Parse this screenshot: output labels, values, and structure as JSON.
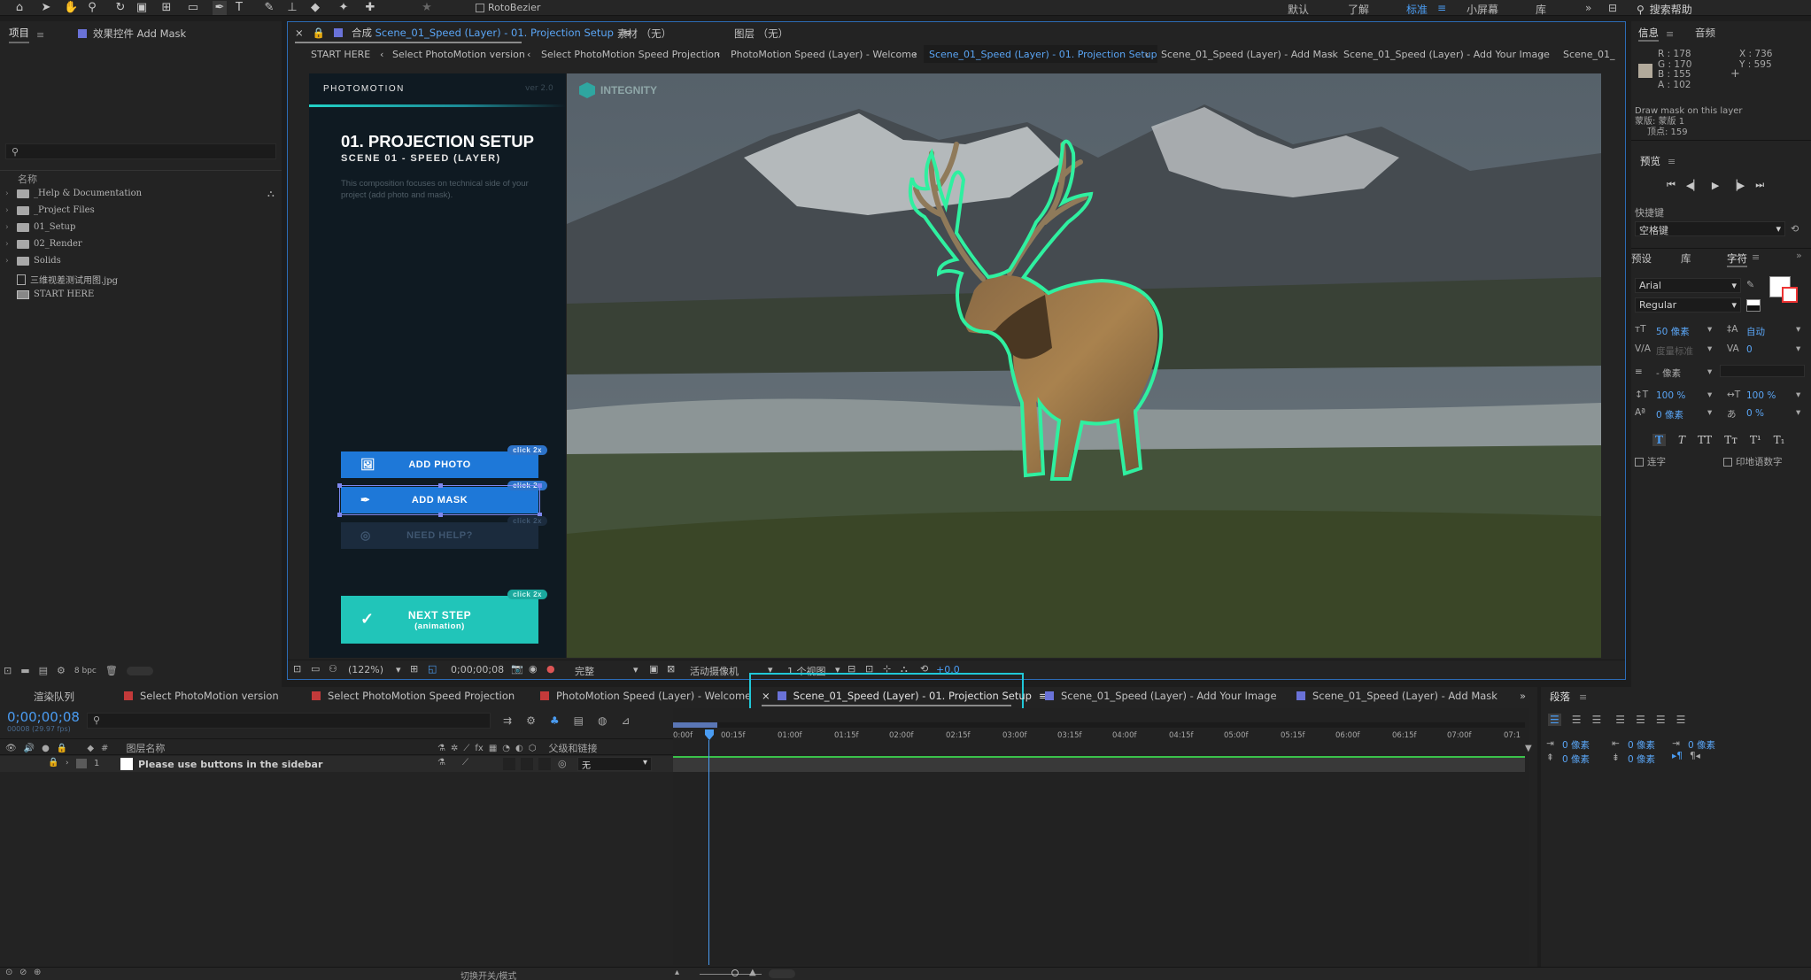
{
  "toolbar": {
    "roto_label": "RotoBezier",
    "workspaces": [
      "默认",
      "了解",
      "标准",
      "小屏幕",
      "库"
    ],
    "search_help": "搜索帮助"
  },
  "project": {
    "tab": "项目",
    "effects_tab": "效果控件 Add Mask",
    "name_col": "名称",
    "items": [
      "_Help & Documentation",
      "_Project Files",
      "01_Setup",
      "02_Render",
      "Solids",
      "三维视差测试用图.jpg",
      "START HERE"
    ],
    "bpc": "8 bpc"
  },
  "comp": {
    "tab_prefix": "合成",
    "tab_name": "Scene_01_Speed (Layer) - 01. Projection Setup",
    "footage_tab": "素材 （无）",
    "layer_tab": "图层 （无）",
    "breadcrumbs": [
      "START HERE",
      "Select PhotoMotion version",
      "Select PhotoMotion Speed Projection",
      "PhotoMotion Speed (Layer) - Welcome",
      "Scene_01_Speed (Layer) - 01. Projection Setup",
      "Scene_01_Speed (Layer) - Add Mask",
      "Scene_01_Speed (Layer) - Add Your Image",
      "Scene_01_"
    ],
    "zoom": "(122%)",
    "timecode": "0;00;00;08",
    "quality": "完整",
    "camera": "活动摄像机",
    "views": "1 个视图",
    "exposure": "+0.0"
  },
  "photomotion": {
    "logo": "PHOTOMOTION",
    "version": "ver 2.0",
    "title": "01. PROJECTION SETUP",
    "subtitle": "SCENE 01 - SPEED (LAYER)",
    "description": "This composition focuses on technical side of your project (add photo and mask).",
    "add_photo": "ADD PHOTO",
    "add_mask": "ADD MASK",
    "need_help": "NEED HELP?",
    "click_tag": "click 2x",
    "next_step": "NEXT STEP",
    "next_sub": "(animation)",
    "brand": "INTEGNITY"
  },
  "info": {
    "tab": "信息",
    "audio_tab": "音频",
    "r": "R : 178",
    "g": "G : 170",
    "b": "B : 155",
    "a": "A : 102",
    "x": "X : 736",
    "y": "Y : 595",
    "swatch": "#b2aa9b",
    "hint1": "Draw mask on this layer",
    "hint2": "蒙版: 蒙版 1",
    "hint3": "顶点: 159"
  },
  "preview": {
    "tab": "预览",
    "shortcut_label": "快捷键",
    "shortcut_value": "空格键"
  },
  "character": {
    "tabs": [
      "预设",
      "库",
      "字符"
    ],
    "font": "Arial",
    "style": "Regular",
    "size": "50 像素",
    "leading": "自动",
    "kerning": "度量标准",
    "tracking": "0",
    "stroke": "- 像素",
    "vscale": "100 %",
    "hscale": "100 %",
    "baseline": "0 像素",
    "tsume": "0 %",
    "ligature": "连字",
    "hindi": "印地语数字"
  },
  "timeline": {
    "render_queue": "渲染队列",
    "tabs": [
      {
        "label": "Select PhotoMotion version",
        "color": "#c33a3a"
      },
      {
        "label": "Select PhotoMotion Speed Projection",
        "color": "#c33a3a"
      },
      {
        "label": "PhotoMotion Speed (Layer) - Welcome",
        "color": "#c33a3a"
      },
      {
        "label": "Scene_01_Speed (Layer) - 01. Projection Setup",
        "color": "#6a72d8"
      },
      {
        "label": "Scene_01_Speed (Layer) - Add Your Image",
        "color": "#6a72d8"
      },
      {
        "label": "Scene_01_Speed (Layer) - Add Mask",
        "color": "#6a72d8"
      }
    ],
    "timecode": "0;00;00;08",
    "frame_info": "00008 (29.97 fps)",
    "col_layer": "图层名称",
    "col_parent": "父级和链接",
    "layer_num": "1",
    "layer_name": "Please use buttons in the sidebar",
    "parent_value": "无",
    "ruler": [
      "0:00f",
      "00:15f",
      "01:00f",
      "01:15f",
      "02:00f",
      "02:15f",
      "03:00f",
      "03:15f",
      "04:00f",
      "04:15f",
      "05:00f",
      "05:15f",
      "06:00f",
      "06:15f",
      "07:00f",
      "07:1"
    ],
    "switch_mode": "切换开关/模式"
  },
  "paragraph": {
    "tab": "段落",
    "indent_l": "0 像素",
    "indent_first": "0 像素",
    "indent_r": "0 像素",
    "space_before": "0 像素",
    "space_after": "0 像素"
  },
  "colors": {
    "accent": "#4a9cf2",
    "mask": "#2ff0a0",
    "highlight": "#20c8d8"
  }
}
